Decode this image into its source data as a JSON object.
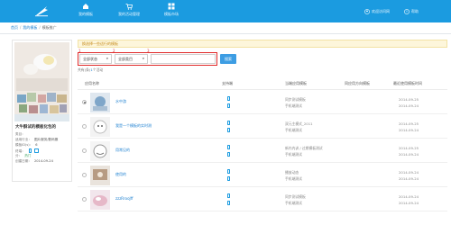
{
  "nav": {
    "items": [
      {
        "label": "我的模板"
      },
      {
        "label": "我的活动管理"
      },
      {
        "label": "模板市场"
      }
    ],
    "user_label": "欢迎访问网",
    "help_label": "帮助"
  },
  "breadcrumb": {
    "items": [
      "首页",
      "我的模板",
      "模板推广"
    ]
  },
  "card": {
    "title": "大牛酥试的模板化包的",
    "rows": [
      {
        "key": "类目：",
        "value": ""
      },
      {
        "key": "适用行业：",
        "value": "图片服务/数码服"
      },
      {
        "key": "模板ID(s)：",
        "value": "6"
      },
      {
        "key": "终端：",
        "value": ""
      },
      {
        "key": "分：",
        "value": "热门"
      },
      {
        "key": "创建日期：",
        "value": "2014-09-24"
      }
    ]
  },
  "notice": {
    "text": "换选择一些适行的模板"
  },
  "filters": {
    "step1": "1",
    "step2": "2",
    "step3": "3",
    "status_value": "全部状态",
    "category_value": "全部类目",
    "search_placeholder": "",
    "search_button": "搜索",
    "result_prefix": "共有(条)",
    "result_count": "1",
    "result_suffix": "个活动"
  },
  "table": {
    "headers": [
      "应用名称",
      "支持端",
      "当端应用模板",
      "同应用方向模板",
      "最近使用模板时间"
    ],
    "rows": [
      {
        "name": "水中游",
        "dev1": "同步测试模板",
        "dev2": "手机端测试",
        "date1": "2014-09-25",
        "date2": "2014-09-24",
        "selected": true
      },
      {
        "name": "我是一个模板的实时测",
        "dev1": "双元主模式_2011",
        "dev2": "手机端测试",
        "date1": "2014-09-25",
        "date2": "2014-09-24",
        "selected": false
      },
      {
        "name": "用常见的",
        "dev1": "新内内训 / 过期模板测试",
        "dev2": "手机端测试",
        "date1": "2014-09-25",
        "date2": "2014-09-24",
        "selected": false
      },
      {
        "name": "使用的",
        "dev1": "播放动态",
        "dev2": "手机端测试",
        "date1": "2014-09-24",
        "date2": "2014-09-24",
        "selected": false
      },
      {
        "name": "zzzRrooJff",
        "dev1": "同步测试模板",
        "dev2": "手机端测试",
        "date1": "2014-09-24",
        "date2": "2014-09-24",
        "selected": false
      }
    ]
  },
  "colors": {
    "topbar": "#1b9be0",
    "link": "#1b7fd0",
    "highlight": "#e02a2a",
    "notice_bg": "#fdf6db"
  }
}
